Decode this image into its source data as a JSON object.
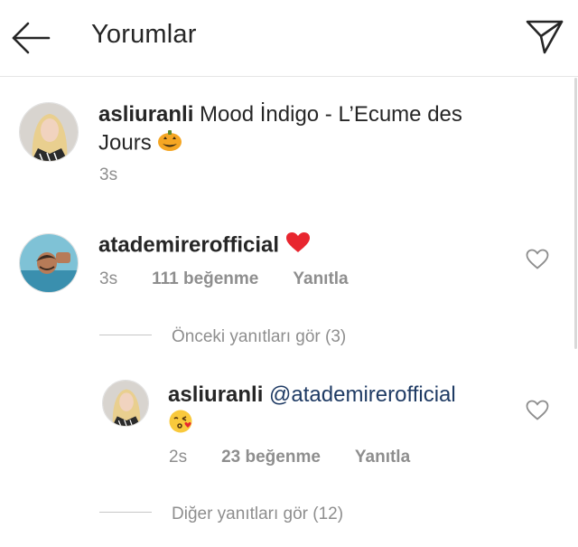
{
  "header": {
    "title": "Yorumlar",
    "back_icon": "arrow-left-icon",
    "share_icon": "paper-plane-icon"
  },
  "caption": {
    "username": "asliuranli",
    "text": "Mood İndigo - L’Ecume des",
    "text_line2": "Jours",
    "emoji": "jack-o-lantern",
    "time": "3s"
  },
  "comments": [
    {
      "username": "atademirerofficial",
      "emoji": "red-heart",
      "time": "3s",
      "likes": "111 beğenme",
      "reply_label": "Yanıtla",
      "view_previous_replies": "Önceki yanıtları gör (3)",
      "replies": [
        {
          "username": "asliuranli",
          "mention": "@atademirerofficial",
          "emoji": "face-blowing-a-kiss",
          "time": "2s",
          "likes": "23 beğenme",
          "reply_label": "Yanıtla"
        }
      ],
      "view_more_replies": "Diğer yanıtları gör (12)"
    }
  ],
  "colors": {
    "text": "#262626",
    "secondary": "#8e8e8e",
    "mention": "#1f3b64",
    "heart": "#ed4956"
  }
}
